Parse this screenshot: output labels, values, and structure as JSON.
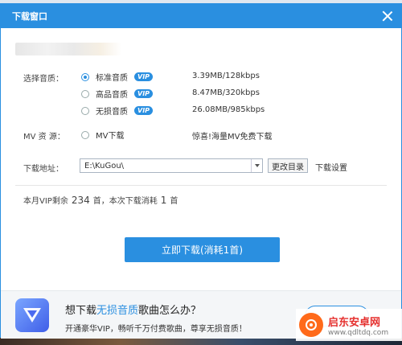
{
  "dialog": {
    "title": "下载窗口"
  },
  "quality": {
    "label": "选择音质：",
    "options": [
      {
        "name": "标准音质",
        "vip": "VIP",
        "size": "3.39MB/128kbps",
        "checked": true
      },
      {
        "name": "高品音质",
        "vip": "VIP",
        "size": "8.47MB/320kbps",
        "checked": false
      },
      {
        "name": "无损音质",
        "vip": "VIP",
        "size": "26.08MB/985kbps",
        "checked": false
      }
    ]
  },
  "mv": {
    "label": "MV 资 源：",
    "option": "MV下载",
    "note": "惊喜!海量MV免费下载"
  },
  "path": {
    "label": "下载地址：",
    "value": "E:\\KuGou\\",
    "change_button": "更改目录",
    "settings_link": "下载设置"
  },
  "vip_quota": {
    "prefix": "本月VIP剩余",
    "remaining": "234",
    "mid": "首，本次下载消耗",
    "cost": "1",
    "suffix": "首"
  },
  "download_button": "立即下载(消耗1首)",
  "promo": {
    "title_pre": "想下载",
    "title_highlight": "无损音质",
    "title_post": "歌曲怎么办？",
    "subtitle": "开通豪华VIP，畅听千万付费歌曲，尊享无损音质！"
  },
  "watermark": {
    "name": "启东安卓网",
    "url": "www.qdltdq.com"
  },
  "colors": {
    "accent": "#2a8fe0",
    "watermark": "#e5302e"
  }
}
